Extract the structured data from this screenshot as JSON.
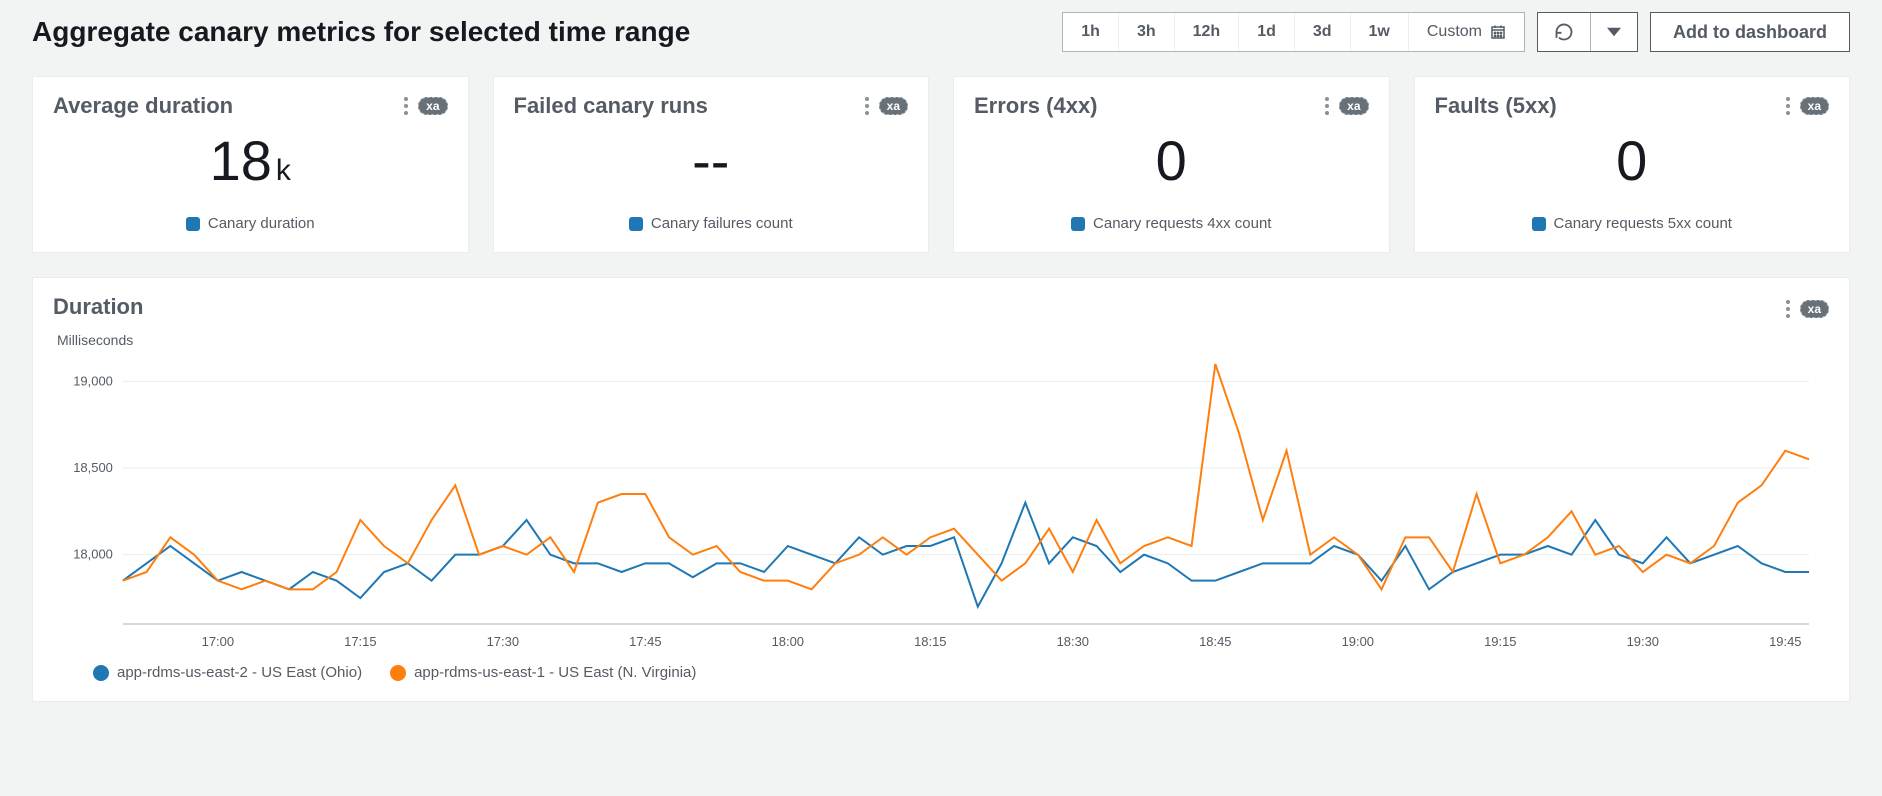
{
  "header": {
    "title": "Aggregate canary metrics for selected time range",
    "time_ranges": [
      "1h",
      "3h",
      "12h",
      "1d",
      "3d",
      "1w"
    ],
    "custom_label": "Custom",
    "add_dashboard_label": "Add to dashboard"
  },
  "metrics": [
    {
      "title": "Average duration",
      "value": "18",
      "unit": "k",
      "legend": "Canary duration",
      "badge": "xa"
    },
    {
      "title": "Failed canary runs",
      "value": "--",
      "unit": "",
      "legend": "Canary failures count",
      "badge": "xa"
    },
    {
      "title": "Errors (4xx)",
      "value": "0",
      "unit": "",
      "legend": "Canary requests 4xx count",
      "badge": "xa"
    },
    {
      "title": "Faults (5xx)",
      "value": "0",
      "unit": "",
      "legend": "Canary requests 5xx count",
      "badge": "xa"
    }
  ],
  "duration_panel": {
    "title": "Duration",
    "ylabel": "Milliseconds",
    "badge": "xa",
    "legend": [
      {
        "name": "app-rdms-us-east-2 - US East (Ohio)",
        "color": "#1f77b4"
      },
      {
        "name": "app-rdms-us-east-1 - US East (N. Virginia)",
        "color": "#ff7f0e"
      }
    ]
  },
  "chart_data": {
    "type": "line",
    "title": "Duration",
    "xlabel": "",
    "ylabel": "Milliseconds",
    "ylim": [
      17600,
      19100
    ],
    "y_ticks": [
      18000,
      18500,
      19000
    ],
    "x_ticks": [
      "17:00",
      "17:15",
      "17:30",
      "17:45",
      "18:00",
      "18:15",
      "18:30",
      "18:45",
      "19:00",
      "19:15",
      "19:30",
      "19:45"
    ],
    "x": [
      "16:50",
      "16:52",
      "16:55",
      "16:57",
      "17:00",
      "17:02",
      "17:05",
      "17:07",
      "17:10",
      "17:12",
      "17:15",
      "17:17",
      "17:20",
      "17:22",
      "17:25",
      "17:27",
      "17:30",
      "17:32",
      "17:35",
      "17:37",
      "17:40",
      "17:42",
      "17:45",
      "17:47",
      "17:50",
      "17:52",
      "17:55",
      "17:57",
      "18:00",
      "18:02",
      "18:05",
      "18:07",
      "18:10",
      "18:12",
      "18:15",
      "18:17",
      "18:20",
      "18:22",
      "18:25",
      "18:27",
      "18:30",
      "18:32",
      "18:35",
      "18:37",
      "18:40",
      "18:42",
      "18:45",
      "18:47",
      "18:50",
      "18:52",
      "18:55",
      "18:57",
      "19:00",
      "19:02",
      "19:05",
      "19:07",
      "19:10",
      "19:12",
      "19:15",
      "19:17",
      "19:20",
      "19:22",
      "19:25",
      "19:27",
      "19:30",
      "19:32",
      "19:35",
      "19:37",
      "19:40",
      "19:42",
      "19:45",
      "19:47"
    ],
    "series": [
      {
        "name": "app-rdms-us-east-2 - US East (Ohio)",
        "color": "#1f77b4",
        "values": [
          17850,
          17950,
          18050,
          17950,
          17850,
          17900,
          17850,
          17800,
          17900,
          17850,
          17750,
          17900,
          17950,
          17850,
          18000,
          18000,
          18050,
          18200,
          18000,
          17950,
          17950,
          17900,
          17950,
          17950,
          17870,
          17950,
          17950,
          17900,
          18050,
          18000,
          17950,
          18100,
          18000,
          18050,
          18050,
          18100,
          17700,
          17950,
          18300,
          17950,
          18100,
          18050,
          17900,
          18000,
          17950,
          17850,
          17850,
          17900,
          17950,
          17950,
          17950,
          18050,
          18000,
          17850,
          18050,
          17800,
          17900,
          17950,
          18000,
          18000,
          18050,
          18000,
          18200,
          18000,
          17950,
          18100,
          17950,
          18000,
          18050,
          17950,
          17900,
          17900
        ]
      },
      {
        "name": "app-rdms-us-east-1 - US East (N. Virginia)",
        "color": "#ff7f0e",
        "values": [
          17850,
          17900,
          18100,
          18000,
          17850,
          17800,
          17850,
          17800,
          17800,
          17900,
          18200,
          18050,
          17950,
          18200,
          18400,
          18000,
          18050,
          18000,
          18100,
          17900,
          18300,
          18350,
          18350,
          18100,
          18000,
          18050,
          17900,
          17850,
          17850,
          17800,
          17950,
          18000,
          18100,
          18000,
          18100,
          18150,
          18000,
          17850,
          17950,
          18150,
          17900,
          18200,
          17950,
          18050,
          18100,
          18050,
          19100,
          18700,
          18200,
          18600,
          18000,
          18100,
          18000,
          17800,
          18100,
          18100,
          17900,
          18350,
          17950,
          18000,
          18100,
          18250,
          18000,
          18050,
          17900,
          18000,
          17950,
          18050,
          18300,
          18400,
          18600,
          18550
        ]
      }
    ]
  }
}
